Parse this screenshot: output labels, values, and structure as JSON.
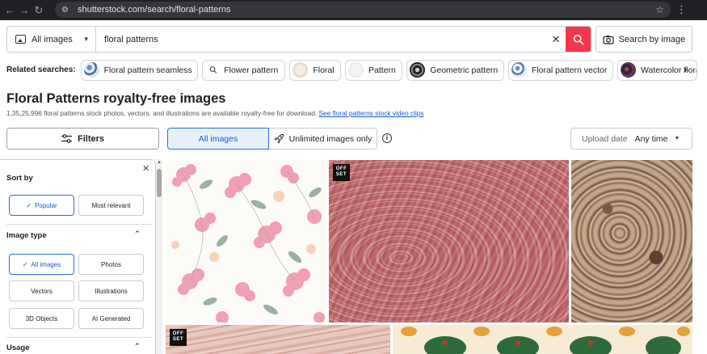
{
  "browser": {
    "url": "shutterstock.com/search/floral-patterns"
  },
  "search": {
    "type_label": "All images",
    "query": "floral patterns",
    "search_by_image_label": "Search by image"
  },
  "related": {
    "label": "Related searches:",
    "items": [
      {
        "label": "Floral pattern seamless"
      },
      {
        "label": "Flower pattern"
      },
      {
        "label": "Floral"
      },
      {
        "label": "Pattern"
      },
      {
        "label": "Geometric pattern"
      },
      {
        "label": "Floral pattern vector"
      },
      {
        "label": "Watercolor floral"
      }
    ]
  },
  "heading": {
    "title": "Floral Patterns royalty-free images",
    "subtitle": "1,35,25,996 floral patterns stock photos, vectors, and illustrations are available royalty-free for download.",
    "link": "See floral patterns stock video clips"
  },
  "toolbar": {
    "filters_label": "Filters",
    "all_images_label": "All images",
    "unlimited_label": "Unlimited images only",
    "upload_date_label": "Upload date",
    "upload_date_value": "Any time"
  },
  "sidebar": {
    "sort_by_title": "Sort by",
    "sort_options": [
      "Popular",
      "Most relevant"
    ],
    "image_type_title": "Image type",
    "image_type_options": [
      "All images",
      "Photos",
      "Vectors",
      "Illustrations",
      "3D Objects",
      "AI Generated"
    ],
    "usage_title": "Usage"
  },
  "badges": {
    "offset_line1": "OFF",
    "offset_line2": "SET"
  },
  "colors": {
    "accent_red": "#f5374c",
    "accent_blue": "#2a6edb",
    "link_blue": "#1a56d6"
  }
}
